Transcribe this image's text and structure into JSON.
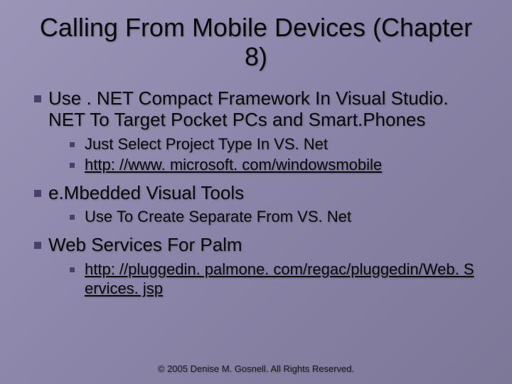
{
  "title": "Calling From Mobile Devices (Chapter 8)",
  "items": [
    {
      "text": "Use . NET Compact Framework In Visual Studio. NET To Target Pocket PCs and Smart.Phones",
      "sub": [
        {
          "text": "Just Select Project Type In VS. Net",
          "link": false
        },
        {
          "text": "http: //www. microsoft. com/windowsmobile",
          "link": true
        }
      ]
    },
    {
      "text": "e.Mbedded Visual Tools",
      "sub": [
        {
          "text": "Use To Create Separate From VS. Net",
          "link": false
        }
      ]
    },
    {
      "text": "Web Services For Palm",
      "sub": [
        {
          "text": "http: //pluggedin. palmone. com/regac/pluggedin/Web. S ervices. jsp",
          "link": true
        }
      ]
    }
  ],
  "footer": "© 2005 Denise M. Gosnell.  All Rights Reserved."
}
